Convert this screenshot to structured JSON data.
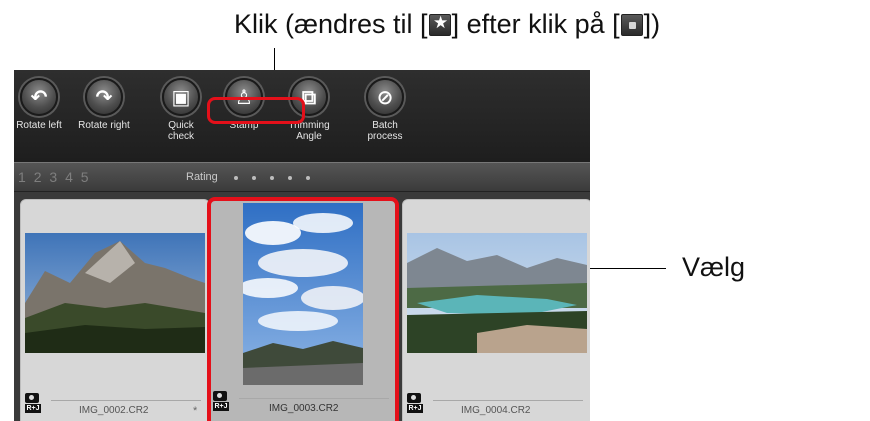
{
  "callouts": {
    "top_before": "Klik (ændres til [",
    "top_middle": "] efter klik på [",
    "top_after": "])",
    "right": "Vælg"
  },
  "toolbar": {
    "items": [
      {
        "label": "Rotate left",
        "icon": "rotate-left-icon"
      },
      {
        "label": "Rotate right",
        "icon": "rotate-right-icon"
      },
      {
        "label": "Quick\ncheck",
        "icon": "quick-check-icon"
      },
      {
        "label": "Stamp",
        "icon": "stamp-icon"
      },
      {
        "label": "Trimming\nAngle",
        "icon": "trimming-angle-icon"
      },
      {
        "label": "Batch\nprocess",
        "icon": "batch-process-icon"
      }
    ]
  },
  "rating_bar": {
    "numbers": [
      "1",
      "2",
      "3",
      "4",
      "5"
    ],
    "label": "Rating",
    "dots": 5
  },
  "thumbnails": [
    {
      "filename": "IMG_0002.CR2",
      "badge": "R+J",
      "marker": "*",
      "selected": false
    },
    {
      "filename": "IMG_0003.CR2",
      "badge": "R+J",
      "selected": true
    },
    {
      "filename": "IMG_0004.CR2",
      "badge": "R+J",
      "selected": false
    }
  ],
  "colors": {
    "highlight": "#e4101a",
    "toolbar_bg": "#222222",
    "card_bg": "#d7d7d7",
    "selected_card_bg": "#b7b7b7"
  }
}
